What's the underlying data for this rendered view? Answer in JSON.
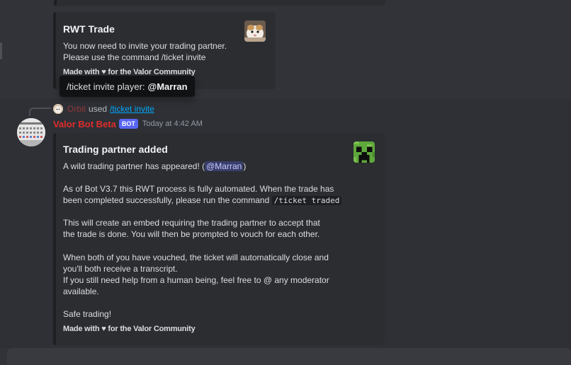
{
  "embed1": {
    "title": "RWT Trade",
    "description_line1": "You now need to invite your trading partner.",
    "description_line2": "Please use the command /ticket invite",
    "footer": "Made with ♥ for the Valor Community",
    "thumbnail_icon": "hamster-photo-icon"
  },
  "tooltip": {
    "prefix": "/ticket invite player:",
    "mention": "@Marran"
  },
  "reply": {
    "username": "Orbit",
    "used_text": "used",
    "command": "/ticket invite"
  },
  "message": {
    "author": "Valor Bot Beta",
    "bot_tag": "BOT",
    "timestamp": "Today at 4:42 AM"
  },
  "embed2": {
    "title": "Trading partner added",
    "line1_prefix": "A wild trading partner has appeared! (",
    "line1_mention": "@Marran",
    "line1_suffix": ")",
    "para2_line1": "As of Bot V3.7 this RWT process is fully automated. When the trade has",
    "para2_line2_prefix": "been completed successfully, please run the command ",
    "para2_code": "/ticket traded",
    "para3_line1": "This will create an embed requiring the trading partner to accept that",
    "para3_line2": "the trade is done. You will then be prompted to vouch for each other.",
    "para4_line1": "When both of you have vouched, the ticket will automatically close and",
    "para4_line2": "you'll both receive a transcript.",
    "para4_line3": "If you still need help from a human being, feel free to @ any moderator",
    "para4_line4": "available.",
    "para5": "Safe trading!",
    "footer": "Made with ♥ for the Valor Community",
    "thumbnail_icon": "creeper-face-icon"
  },
  "colors": {
    "background": "#313338",
    "embed_bg": "#2b2d31",
    "username": "#e12c2c",
    "bot_tag": "#5865f2",
    "link": "#00a8fc"
  }
}
